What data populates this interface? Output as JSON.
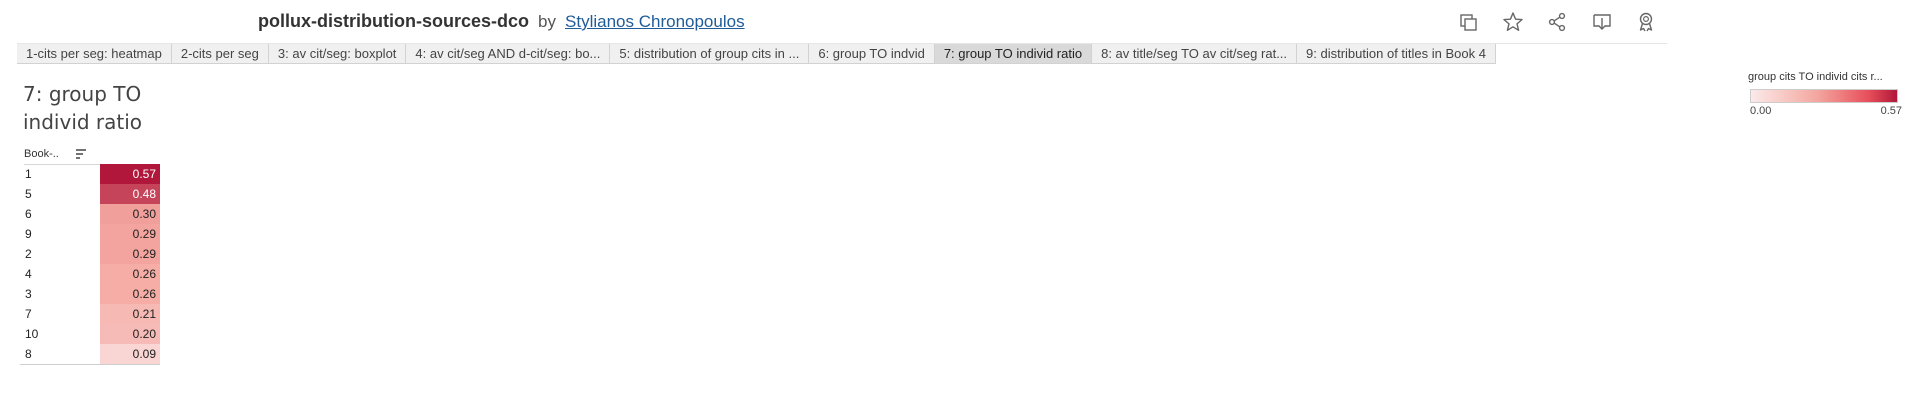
{
  "header": {
    "workbook_title": "pollux-distribution-sources-dco",
    "by_label": "by",
    "author": "Stylianos Chronopoulos",
    "actions": [
      {
        "name": "duplicate-icon"
      },
      {
        "name": "star-icon"
      },
      {
        "name": "share-icon"
      },
      {
        "name": "download-icon"
      },
      {
        "name": "badge-icon"
      }
    ]
  },
  "tabs": [
    {
      "label": "1-cits per seg: heatmap",
      "active": false
    },
    {
      "label": "2-cits per seg",
      "active": false
    },
    {
      "label": "3: av cit/seg: boxplot",
      "active": false
    },
    {
      "label": "4: av cit/seg AND d-cit/seg: bo...",
      "active": false
    },
    {
      "label": "5: distribution of group cits in ...",
      "active": false
    },
    {
      "label": "6: group TO indvid",
      "active": false
    },
    {
      "label": "7: group TO individ ratio",
      "active": true
    },
    {
      "label": "8: av title/seg TO av cit/seg rat...",
      "active": false
    },
    {
      "label": "9: distribution of titles in Book 4",
      "active": false
    }
  ],
  "sheet_title": "7: group TO individ ratio",
  "legend": {
    "title": "group cits TO individ cits r...",
    "min_label": "0.00",
    "max_label": "0.57"
  },
  "chart_data": {
    "type": "heatmap",
    "title": "7: group TO individ ratio",
    "row_header": "Book-..",
    "rows": [
      "1",
      "5",
      "6",
      "9",
      "2",
      "4",
      "3",
      "7",
      "10",
      "8"
    ],
    "values": [
      0.57,
      0.48,
      0.3,
      0.29,
      0.29,
      0.26,
      0.26,
      0.21,
      0.2,
      0.09
    ],
    "labels": [
      "0.57",
      "0.48",
      "0.30",
      "0.29",
      "0.29",
      "0.26",
      "0.26",
      "0.21",
      "0.20",
      "0.09"
    ],
    "color_range": [
      0.0,
      0.57
    ],
    "colors": {
      "low": "#fbeaea",
      "mid": "#f4a7a0",
      "high": "#b0173a"
    }
  }
}
